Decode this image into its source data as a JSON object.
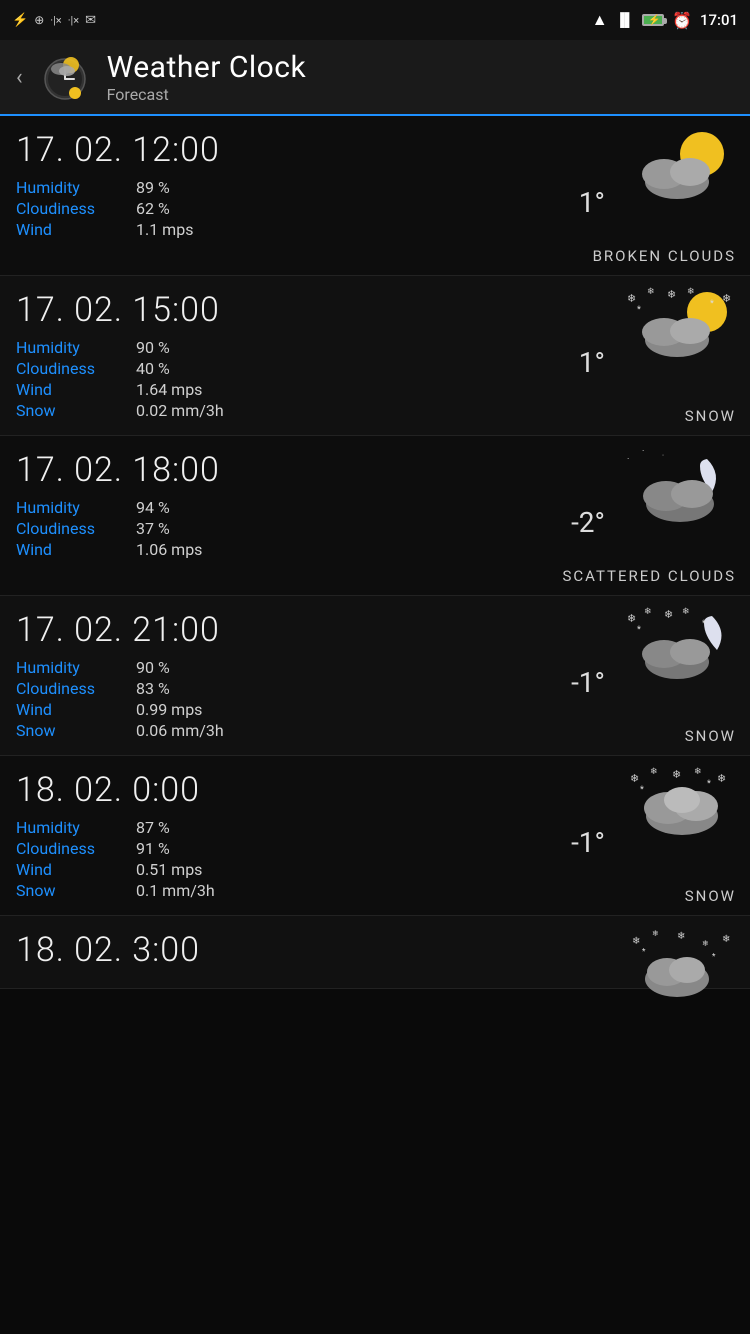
{
  "statusBar": {
    "time": "17:01",
    "icons": [
      "usb",
      "notification",
      "signal-x",
      "signal-x",
      "email"
    ],
    "rightIcons": [
      "wifi",
      "signal",
      "battery",
      "alarm"
    ]
  },
  "header": {
    "title": "Weather Clock",
    "subtitle": "Forecast",
    "backLabel": "‹"
  },
  "forecasts": [
    {
      "datetime": "17. 02. 12:00",
      "humidity": "89 %",
      "cloudiness": "62 %",
      "wind": "1.1 mps",
      "snow": null,
      "temperature": "1°",
      "condition": "BROKEN CLOUDS",
      "iconType": "sun-cloud"
    },
    {
      "datetime": "17. 02. 15:00",
      "humidity": "90 %",
      "cloudiness": "40 %",
      "wind": "1.64 mps",
      "snow": "0.02 mm/3h",
      "temperature": "1°",
      "condition": "SNOW",
      "iconType": "sun-snow"
    },
    {
      "datetime": "17. 02. 18:00",
      "humidity": "94 %",
      "cloudiness": "37 %",
      "wind": "1.06 mps",
      "snow": null,
      "temperature": "-2°",
      "condition": "SCATTERED CLOUDS",
      "iconType": "moon-cloud"
    },
    {
      "datetime": "17. 02. 21:00",
      "humidity": "90 %",
      "cloudiness": "83 %",
      "wind": "0.99 mps",
      "snow": "0.06 mm/3h",
      "temperature": "-1°",
      "condition": "SNOW",
      "iconType": "moon-snow"
    },
    {
      "datetime": "18. 02. 0:00",
      "humidity": "87 %",
      "cloudiness": "91 %",
      "wind": "0.51 mps",
      "snow": "0.1 mm/3h",
      "temperature": "-1°",
      "condition": "SNOW",
      "iconType": "cloud-snow"
    },
    {
      "datetime": "18. 02. 3:00",
      "humidity": null,
      "cloudiness": null,
      "wind": null,
      "snow": null,
      "temperature": null,
      "condition": null,
      "iconType": "cloud-snow-small"
    }
  ],
  "labels": {
    "humidity": "Humidity",
    "cloudiness": "Cloudiness",
    "wind": "Wind",
    "snow": "Snow"
  }
}
